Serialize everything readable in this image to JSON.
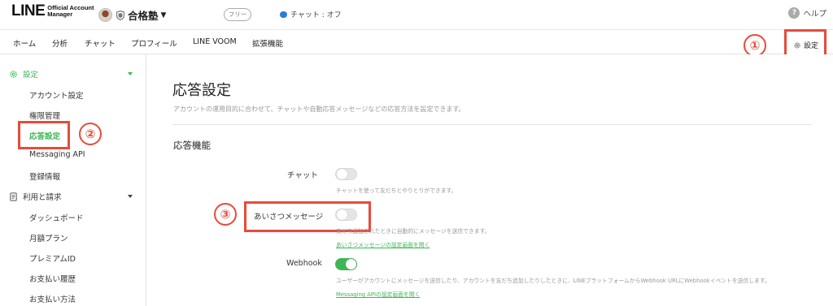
{
  "header": {
    "logo_main": "LINE",
    "logo_sub_1": "Official Account",
    "logo_sub_2": "Manager",
    "account_name": "合格塾",
    "plan_badge": "フリー",
    "chat_status": "チャット : オフ",
    "help_label": "ヘルプ"
  },
  "nav": {
    "items": [
      "ホーム",
      "分析",
      "チャット",
      "プロフィール",
      "LINE VOOM",
      "拡張機能"
    ],
    "settings_label": "設定"
  },
  "sidebar": {
    "section_settings": "設定",
    "settings_items": [
      "アカウント設定",
      "権限管理",
      "応答設定",
      "Messaging API",
      "登録情報"
    ],
    "active_item": "応答設定",
    "section_billing": "利用と請求",
    "billing_items": [
      "ダッシュボード",
      "月額プラン",
      "プレミアムID",
      "お支払い履歴",
      "お支払い方法"
    ]
  },
  "main": {
    "title": "応答設定",
    "description": "アカウントの運用目的に合わせて、チャットや自動応答メッセージなどの応答方法を設定できます。",
    "section_title": "応答機能",
    "rows": [
      {
        "label": "チャット",
        "enabled": false,
        "description": "チャットを使って友だちとやりとりができます。",
        "link": ""
      },
      {
        "label": "あいさつメッセージ",
        "enabled": false,
        "description": "友だち追加されたときに自動的にメッセージを送信できます。",
        "link": "あいさつメッセージの設定画面を開く"
      },
      {
        "label": "Webhook",
        "enabled": true,
        "description": "ユーザーがアカウントにメッセージを送信したり、アカウントを友だち追加したりしたときに、LINEプラットフォームからWebhook URLにWebhookイベントを送信します。",
        "link": "Messaging APIの設定画面を開く"
      }
    ]
  },
  "annotations": {
    "n1": "①",
    "n2": "②",
    "n3": "③"
  },
  "colors": {
    "accent_green": "#3eb655",
    "annotation_red": "#e84a3b"
  },
  "icons": [
    "shield-icon",
    "chat-bubble-icon",
    "help-icon",
    "gear-icon",
    "receipt-icon",
    "caret-down-icon"
  ]
}
